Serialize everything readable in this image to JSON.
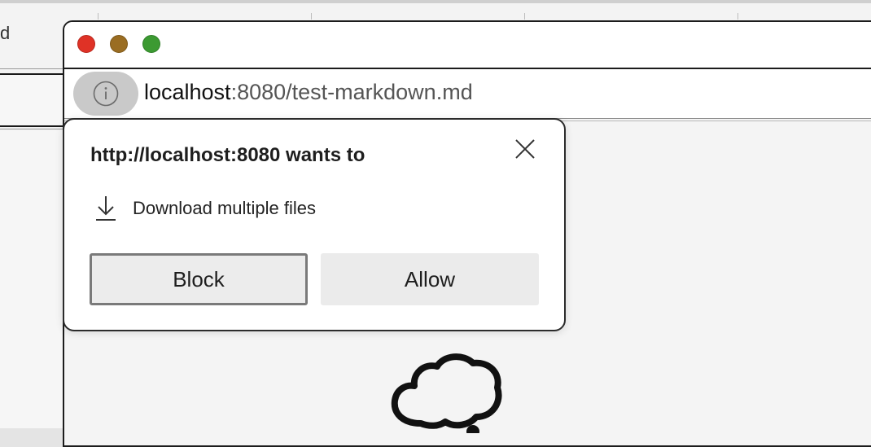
{
  "background_window": {
    "title_fragment": "d"
  },
  "browser": {
    "traffic_lights": {
      "close_color": "#df3226",
      "minimize_color": "#9a6d22",
      "zoom_color": "#3c9a32"
    },
    "address_bar": {
      "host": "localhost",
      "rest": ":8080/test-markdown.md",
      "site_info_icon": "info-circle-icon"
    },
    "content": {
      "illustration_icon": "cloud-icon"
    }
  },
  "permission_popup": {
    "title": "http://localhost:8080 wants to",
    "close_icon": "close-icon",
    "permission": {
      "icon": "download-icon",
      "label": "Download multiple files"
    },
    "buttons": {
      "block_label": "Block",
      "allow_label": "Allow"
    }
  }
}
